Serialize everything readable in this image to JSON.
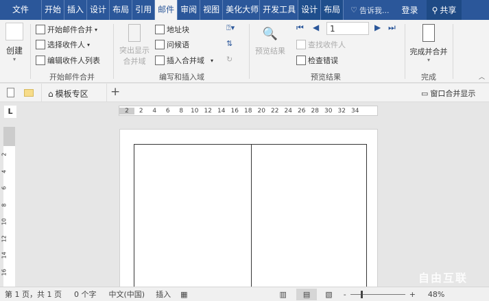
{
  "tabs": [
    "文件",
    "开始",
    "插入",
    "设计",
    "布局",
    "引用",
    "邮件",
    "审阅",
    "视图",
    "美化大师",
    "开发工具",
    "设计",
    "布局"
  ],
  "active_tab": "邮件",
  "tell_me": "告诉我...",
  "login": "登录",
  "share": "共享",
  "ribbon": {
    "create": "创建",
    "start_merge": "开始邮件合并",
    "select_recipients": "选择收件人",
    "edit_recipients": "编辑收件人列表",
    "group1": "开始邮件合并",
    "highlight_fields": [
      "突出显示",
      "合并域"
    ],
    "address_block": "地址块",
    "greeting_line": "问候语",
    "insert_merge_field": "插入合并域",
    "group2": "编写和插入域",
    "preview_results": "预览结果",
    "record": "1",
    "find_recipient": "查找收件人",
    "check_errors": "检查错误",
    "group3": "预览结果",
    "finish_merge": "完成并合并",
    "group4": "完成"
  },
  "docbar": {
    "template_zone": "模板专区",
    "window_merge": "窗口合并显示"
  },
  "ruler_h": [
    "2",
    "2",
    "4",
    "6",
    "8",
    "10",
    "12",
    "14",
    "16",
    "18",
    "20",
    "22",
    "24",
    "26",
    "28",
    "30",
    "32",
    "34"
  ],
  "ruler_v": [
    "2",
    "4",
    "6",
    "8",
    "10",
    "12",
    "14",
    "16"
  ],
  "status": {
    "page": "第 1 页，共 1 页",
    "words": "0 个字",
    "language": "中文(中国)",
    "mode": "插入",
    "zoom": "48%"
  },
  "zoom_percent": 48,
  "colors": {
    "accent": "#2b579a"
  },
  "watermark": "自由互联"
}
